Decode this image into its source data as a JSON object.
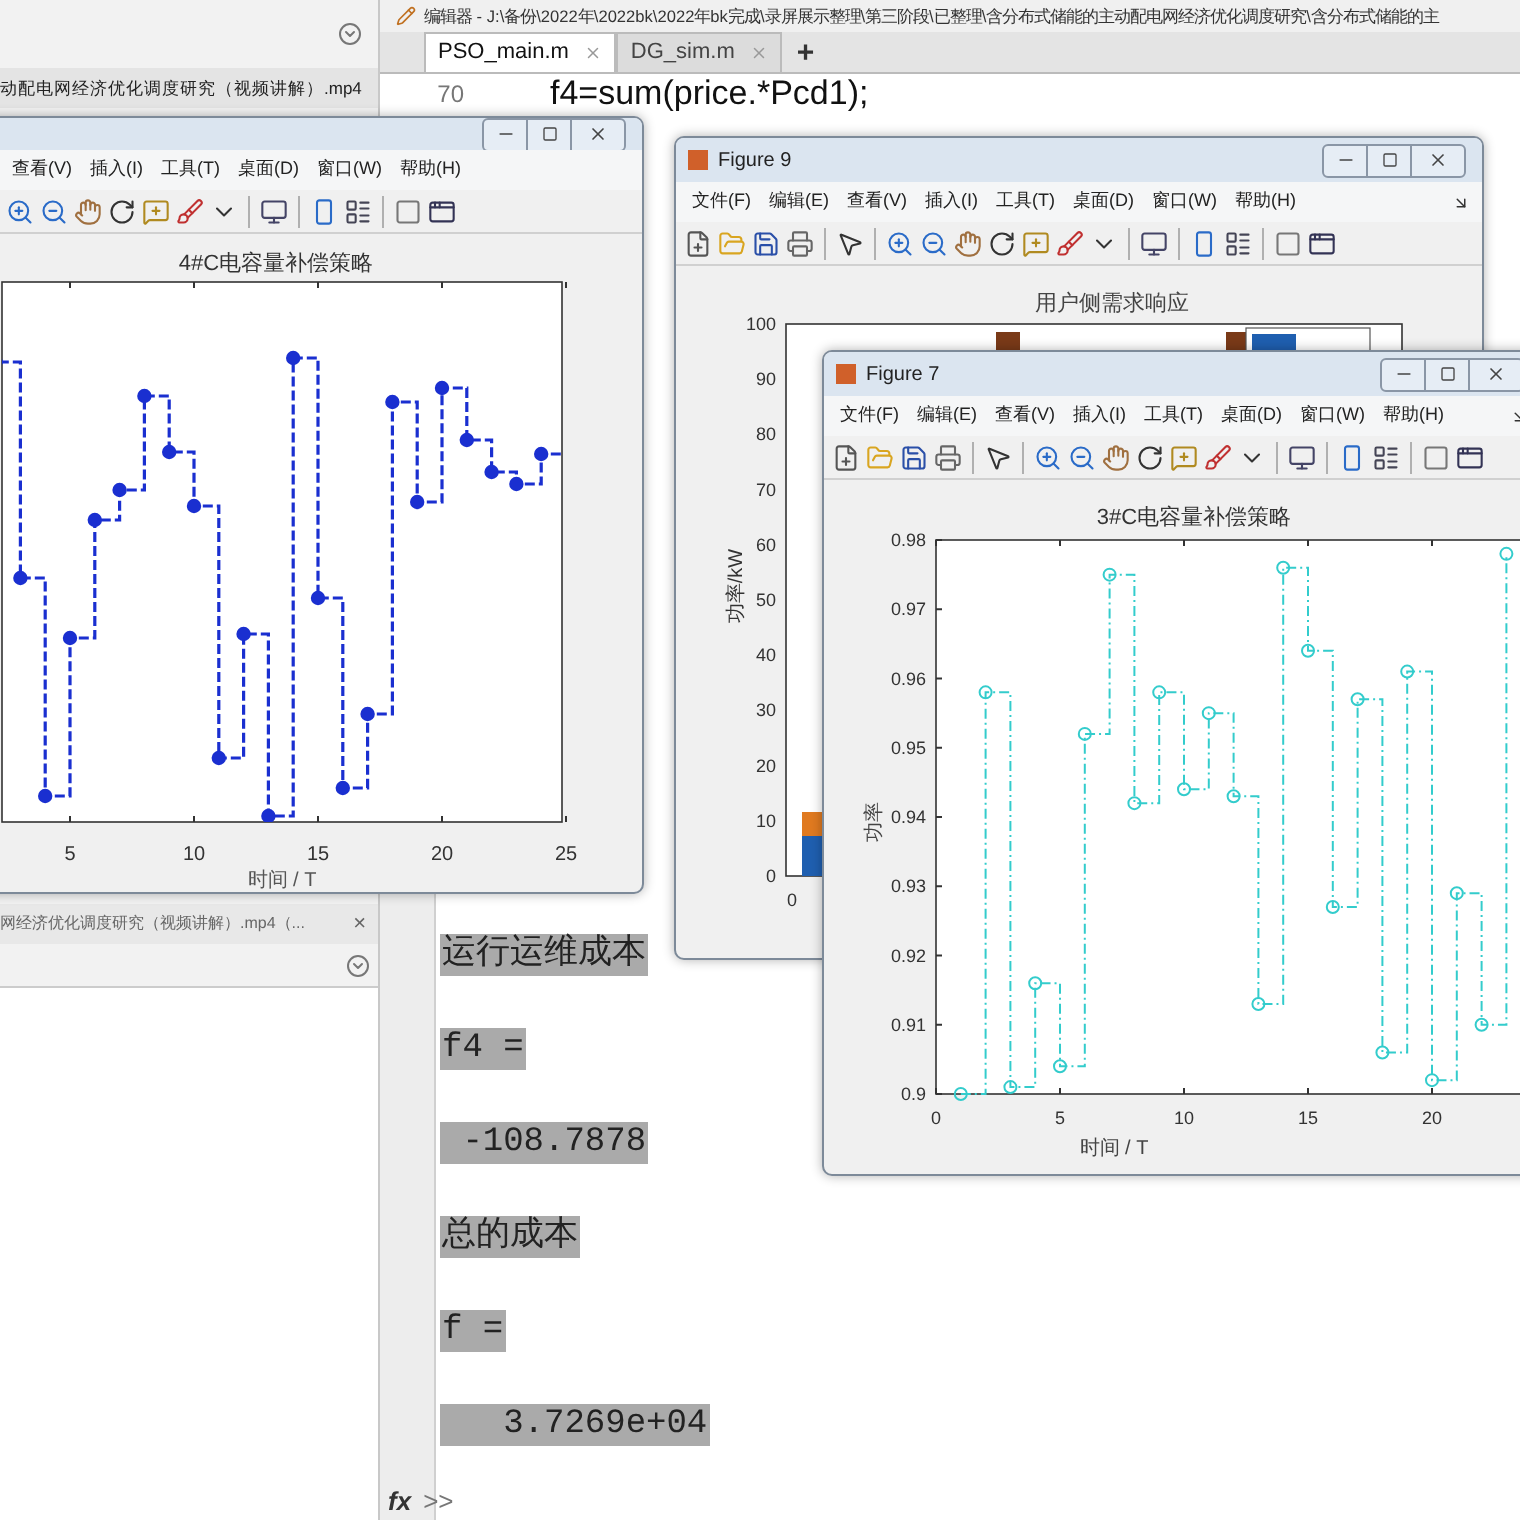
{
  "file_browser": {
    "top_item": "动配电网经济优化调度研究（视频讲解）.mp4",
    "bottom_item": "网经济优化调度研究（视频讲解）.mp4（...",
    "bottom_close": "×"
  },
  "editor": {
    "title": "编辑器 - J:\\备份\\2022年\\2022bk\\2022年bk完成\\录屏展示整理\\第三阶段\\已整理\\含分布式储能的主动配电网经济优化调度研究\\含分布式储能的主",
    "tabs": [
      {
        "label": "PSO_main.m",
        "selected": true
      },
      {
        "label": "DG_sim.m",
        "selected": false
      }
    ],
    "new_tab": "+",
    "code": [
      {
        "line_number": "70",
        "text": "f4=sum(price.*Pcd1);"
      }
    ]
  },
  "command_window": {
    "lines": [
      "运行运维成本",
      "f4 =",
      " -108.7878",
      "总的成本",
      "f =",
      "   3.7269e+04"
    ],
    "prompt_icon": "fx",
    "prompt": ">>"
  },
  "figures": [
    {
      "kind": "stairs",
      "menu": [
        "查看(V)",
        "插入(I)",
        "工具(T)",
        "桌面(D)",
        "窗口(W)",
        "帮助(H)"
      ],
      "plot_title": "4#C电容量补偿策略",
      "xtick_labels": [
        "5",
        "10",
        "15",
        "20",
        "25"
      ],
      "xlabel": "时间 / T"
    },
    {
      "kind": "bars",
      "title": "Figure 9",
      "menu": [
        "文件(F)",
        "编辑(E)",
        "查看(V)",
        "插入(I)",
        "工具(T)",
        "桌面(D)",
        "窗口(W)",
        "帮助(H)"
      ],
      "plot_title": "用户侧需求响应",
      "ylabel": "功率/kW",
      "ytick_labels": [
        "100",
        "90",
        "80",
        "70",
        "60",
        "50",
        "40",
        "30",
        "20",
        "10",
        "0"
      ],
      "xtick_labels": [
        "0"
      ]
    },
    {
      "kind": "line_chart",
      "title": "Figure 7",
      "menu": [
        "文件(F)",
        "编辑(E)",
        "查看(V)",
        "插入(I)",
        "工具(T)",
        "桌面(D)",
        "窗口(W)",
        "帮助(H)"
      ],
      "chart_data": {
        "type": "line",
        "title": "3#C电容量补偿策略",
        "xlabel": "时间 / T",
        "ylabel": "功率",
        "x": [
          1,
          2,
          2,
          3,
          3,
          4,
          4,
          5,
          5,
          6,
          6,
          7,
          7,
          8,
          8,
          9,
          9,
          10,
          10,
          11,
          11,
          12,
          12,
          13,
          13,
          14,
          14,
          15,
          15,
          16,
          16,
          17,
          17,
          18,
          18,
          19,
          19,
          20,
          20,
          21,
          21,
          22,
          22,
          23,
          23
        ],
        "series": [
          {
            "color": "#33cccc",
            "line_style": "dashdot",
            "marker": "o",
            "values": [
              0.9,
              0.9,
              0.958,
              0.958,
              0.901,
              0.901,
              0.916,
              0.916,
              0.904,
              0.904,
              0.952,
              0.952,
              0.975,
              0.975,
              0.942,
              0.942,
              0.958,
              0.958,
              0.944,
              0.944,
              0.955,
              0.955,
              0.943,
              0.943,
              0.913,
              0.913,
              0.976,
              0.976,
              0.964,
              0.964,
              0.927,
              0.927,
              0.957,
              0.957,
              0.906,
              0.906,
              0.961,
              0.961,
              0.902,
              0.902,
              0.929,
              0.929,
              0.91,
              0.91,
              0.978
            ]
          }
        ],
        "xlim": [
          0,
          25
        ],
        "ylim": [
          0.9,
          0.98
        ],
        "xticks": [
          0,
          5,
          10,
          15,
          20
        ],
        "yticks": [
          0.9,
          0.91,
          0.92,
          0.93,
          0.94,
          0.95,
          0.96,
          0.97,
          0.98
        ]
      }
    }
  ]
}
